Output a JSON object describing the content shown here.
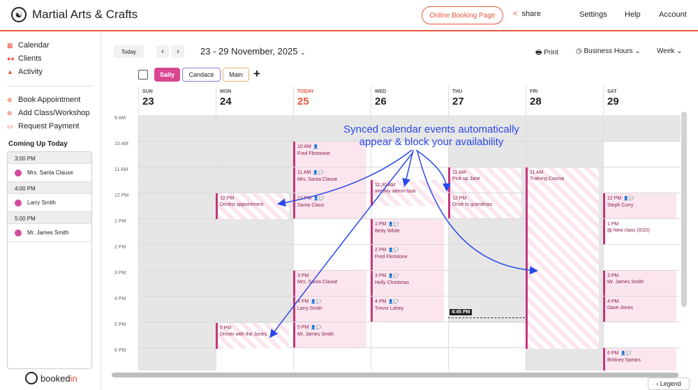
{
  "header": {
    "title": "Martial Arts & Crafts",
    "booking_label": "Online Booking Page",
    "share_label": "share",
    "settings_label": "Settings",
    "help_label": "Help",
    "account_label": "Account"
  },
  "sidebar": {
    "nav": [
      "Calendar",
      "Clients",
      "Activity"
    ],
    "actions": [
      "Book Appointment",
      "Add Class/Workshop",
      "Request Payment"
    ],
    "coming_title": "Coming Up Today",
    "coming": [
      {
        "time": "3:00 PM",
        "name": "Mrs. Santa Clause"
      },
      {
        "time": "4:00 PM",
        "name": "Larry Smith"
      },
      {
        "time": "5:00 PM",
        "name": "Mr. James Smith"
      }
    ],
    "brand_a": "booked",
    "brand_b": "in"
  },
  "toolbar": {
    "today": "Today",
    "prev": "‹",
    "next": "›",
    "range": "23 - 29 November, 2025",
    "print": "Print",
    "business_hours": "Business Hours",
    "view": "Week",
    "chips": [
      "Sally",
      "Candace",
      "Main"
    ],
    "add": "+"
  },
  "days": [
    {
      "name": "SUN",
      "num": "23"
    },
    {
      "name": "MON",
      "num": "24"
    },
    {
      "name": "TODAY",
      "num": "25"
    },
    {
      "name": "WED",
      "num": "26"
    },
    {
      "name": "THU",
      "num": "27"
    },
    {
      "name": "FRI",
      "num": "28"
    },
    {
      "name": "SAT",
      "num": "29"
    }
  ],
  "times": [
    "9 AM",
    "10 AM",
    "11 AM",
    "12 PM",
    "1 PM",
    "2 PM",
    "3 PM",
    "4 PM",
    "5 PM",
    "6 PM"
  ],
  "events": [
    {
      "time": "12 PM",
      "title": "Dentist appointment"
    },
    {
      "time": "5 PM",
      "title": "Dinner with the Jones"
    },
    {
      "time": "10 AM",
      "title": "Fred Flintstone"
    },
    {
      "time": "11 AM",
      "title": "Mrs. Santa Clause"
    },
    {
      "time": "12 PM",
      "title": "Santa Claus"
    },
    {
      "time": "3 PM",
      "title": "Mrs. Santa Clause"
    },
    {
      "time": "4 PM",
      "title": "Larry Smith"
    },
    {
      "time": "5 PM",
      "title": "Mr. James Smith"
    },
    {
      "time": "11:30 AM",
      "title": "Weekly admin task"
    },
    {
      "time": "1 PM",
      "title": "Betty White"
    },
    {
      "time": "2 PM",
      "title": "Fred Flintstone"
    },
    {
      "time": "3 PM",
      "title": "Holly Christmas"
    },
    {
      "time": "4 PM",
      "title": "Trevor Lahey"
    },
    {
      "time": "11 AM",
      "title": "Pick up Jane"
    },
    {
      "time": "12 PM",
      "title": "Drive to grandmas"
    },
    {
      "time": "11 AM",
      "title": "Training Course"
    },
    {
      "time": "12 PM",
      "title": "Steph Curry"
    },
    {
      "time": "1 PM",
      "title": "New class (0/20)"
    },
    {
      "time": "3 PM",
      "title": "Mr. James Smith"
    },
    {
      "time": "4 PM",
      "title": "Dave Jones"
    },
    {
      "time": "6 PM",
      "title": "Brittney Spears"
    }
  ],
  "now_label": "4:45 PM",
  "annotation_line1": "Synced calendar events automatically",
  "annotation_line2": "appear & block your availability",
  "legend": "Legend",
  "colors": {
    "accent": "#e8553a",
    "event": "#c2367a",
    "annotation": "#2a48e8"
  }
}
